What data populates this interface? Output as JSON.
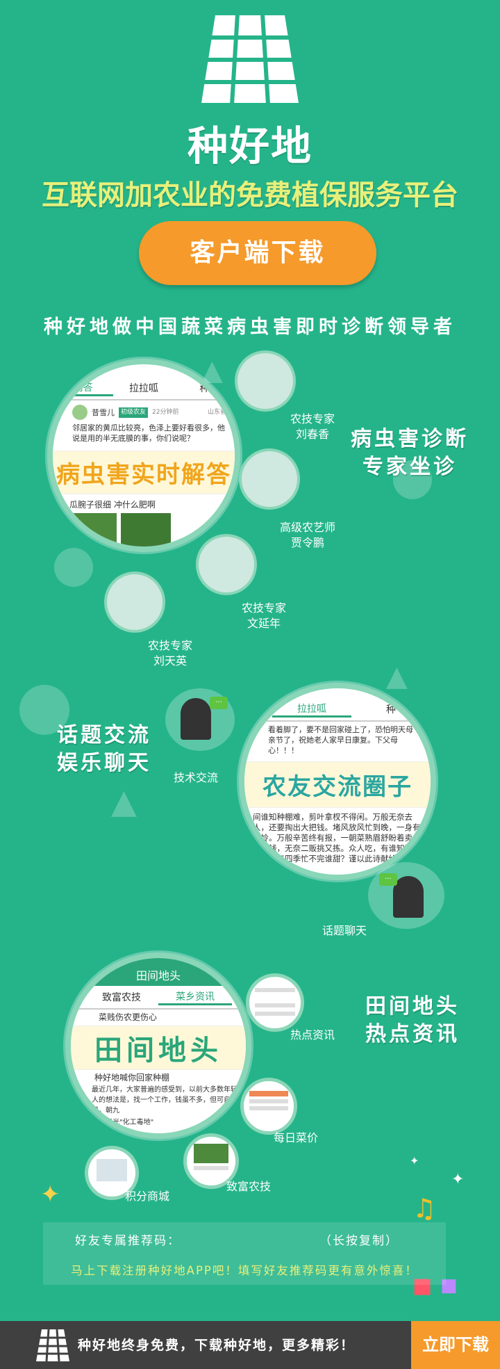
{
  "header": {
    "brand": "种好地",
    "tagline": "互联网加农业的免费植保服务平台",
    "download_button": "客户端下载",
    "leader_text": "种好地做中国蔬菜病虫害即时诊断领导者"
  },
  "section1": {
    "app_tabs": [
      "问答",
      "拉拉呱",
      "种"
    ],
    "post_user": "昔雪儿",
    "post_badge": "初级农友",
    "post_time": "22分钟前",
    "post_location": "山东省",
    "post_text": "邻居家的黄瓜比较亮，色泽上要好看很多，他说是用的半无底膜的事，你们说呢？",
    "big_label": "病虫害实时解答",
    "post2_title": "瓜腕子很细 冲什么肥啊",
    "feature_lines": [
      "病虫害诊断",
      "专家坐诊"
    ],
    "experts": [
      {
        "title": "农技专家",
        "name": "刘春香"
      },
      {
        "title": "高级农艺师",
        "name": "贾令鹏"
      },
      {
        "title": "农技专家",
        "name": "文延年"
      },
      {
        "title": "农技专家",
        "name": "刘天英"
      }
    ]
  },
  "section2": {
    "feature_lines": [
      "话题交流",
      "娱乐聊天"
    ],
    "tech_caption": "技术交流",
    "chat_caption": "话题聊天",
    "app_tabs": [
      "拉拉呱",
      "种"
    ],
    "top_text": "看着脚了，要不是回家碰上了，恐怕明天母亲节了，祝她老人家早日康复。下父母心！！！",
    "big_label": "农友交流圈子",
    "body_text": "间谁知种棚难，剪叶拿杈不得闲。万般无奈去人，还要掏出大把钱。堵风放风忙到晚，一身有谁怜。万般辛苦终有报，一朝菜熟眉舒盼着卖个好价钱，无奈二贩挑又拣。众人吃，有谁知道种棚难一年四季忙不完谁甜？谨以此诗献给种棚的人们"
  },
  "section3": {
    "app_title": "田间地头",
    "app_tabs": [
      "致富农技",
      "菜乡资讯"
    ],
    "headline": "菜贱伤农更伤心",
    "big_label": "田间地头",
    "article_title": "种好地喊你回家种棚",
    "article_text": "最近几年，大家普遍的感受到，以前大多数年轻人的想法是，找一个工作，钱虽不多，但可自足，朝九",
    "article_foot": "毒光\"化工毒地\"",
    "feature_lines": [
      "田间地头",
      "热点资讯"
    ],
    "captions": {
      "hot": "热点资讯",
      "price": "每日菜价",
      "tech": "致富农技",
      "mall": "积分商城"
    }
  },
  "referral": {
    "label": "好友专属推荐码：",
    "copy_hint": "（长按复制）",
    "promo": "马上下载注册种好地APP吧！填写好友推荐码更有意外惊喜！"
  },
  "footer": {
    "slogan": "种好地终身免费，下载种好地，更多精彩！",
    "button": "立即下载"
  },
  "colors": {
    "background": "#25b48a",
    "accent_orange": "#f59a2b",
    "tagline_yellow": "#e8f07a",
    "footer_bar": "#404040"
  }
}
